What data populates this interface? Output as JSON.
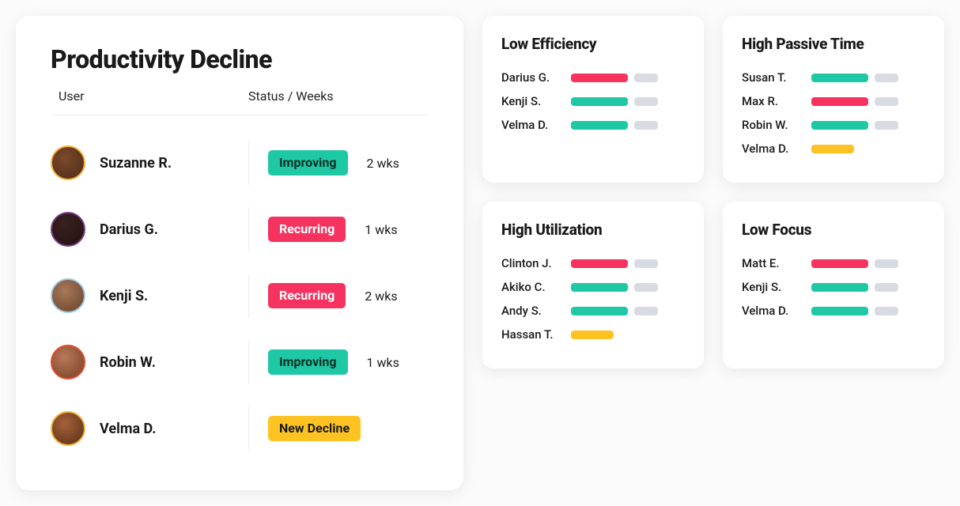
{
  "main": {
    "title": "Productivity Decline",
    "col_user": "User",
    "col_status": "Status / Weeks",
    "rows": [
      {
        "name": "Suzanne R.",
        "status": "Improving",
        "status_variant": "teal",
        "weeks": "2 wks",
        "avatar": "av1"
      },
      {
        "name": "Darius G.",
        "status": "Recurring",
        "status_variant": "pink",
        "weeks": "1 wks",
        "avatar": "av2"
      },
      {
        "name": "Kenji S.",
        "status": "Recurring",
        "status_variant": "pink",
        "weeks": "2 wks",
        "avatar": "av3"
      },
      {
        "name": "Robin W.",
        "status": "Improving",
        "status_variant": "teal",
        "weeks": "1 wks",
        "avatar": "av4"
      },
      {
        "name": "Velma D.",
        "status": "New Decline",
        "status_variant": "amber",
        "weeks": "",
        "avatar": "av5"
      }
    ]
  },
  "cards": [
    {
      "title": "Low Efficiency",
      "rows": [
        {
          "name": "Darius G.",
          "bar1": "pink",
          "bar2": "grey"
        },
        {
          "name": "Kenji S.",
          "bar1": "teal",
          "bar2": "grey"
        },
        {
          "name": "Velma D.",
          "bar1": "teal",
          "bar2": "grey"
        }
      ]
    },
    {
      "title": "High Passive Time",
      "rows": [
        {
          "name": "Susan T.",
          "bar1": "teal",
          "bar2": "grey"
        },
        {
          "name": "Max R.",
          "bar1": "pink",
          "bar2": "grey"
        },
        {
          "name": "Robin W.",
          "bar1": "teal",
          "bar2": "grey"
        },
        {
          "name": "Velma D.",
          "bar1": "amber"
        }
      ]
    },
    {
      "title": "High Utilization",
      "rows": [
        {
          "name": "Clinton J.",
          "bar1": "pink",
          "bar2": "grey"
        },
        {
          "name": "Akiko C.",
          "bar1": "teal",
          "bar2": "grey"
        },
        {
          "name": "Andy S.",
          "bar1": "teal",
          "bar2": "grey"
        },
        {
          "name": "Hassan T.",
          "bar1": "amber"
        }
      ]
    },
    {
      "title": "Low Focus",
      "rows": [
        {
          "name": "Matt E.",
          "bar1": "pink",
          "bar2": "grey"
        },
        {
          "name": "Kenji S.",
          "bar1": "teal",
          "bar2": "grey"
        },
        {
          "name": "Velma D.",
          "bar1": "teal",
          "bar2": "grey"
        }
      ]
    }
  ],
  "colors": {
    "teal": "#1ec8a5",
    "pink": "#f6335e",
    "amber": "#ffc223",
    "grey": "#d9dbe3"
  }
}
